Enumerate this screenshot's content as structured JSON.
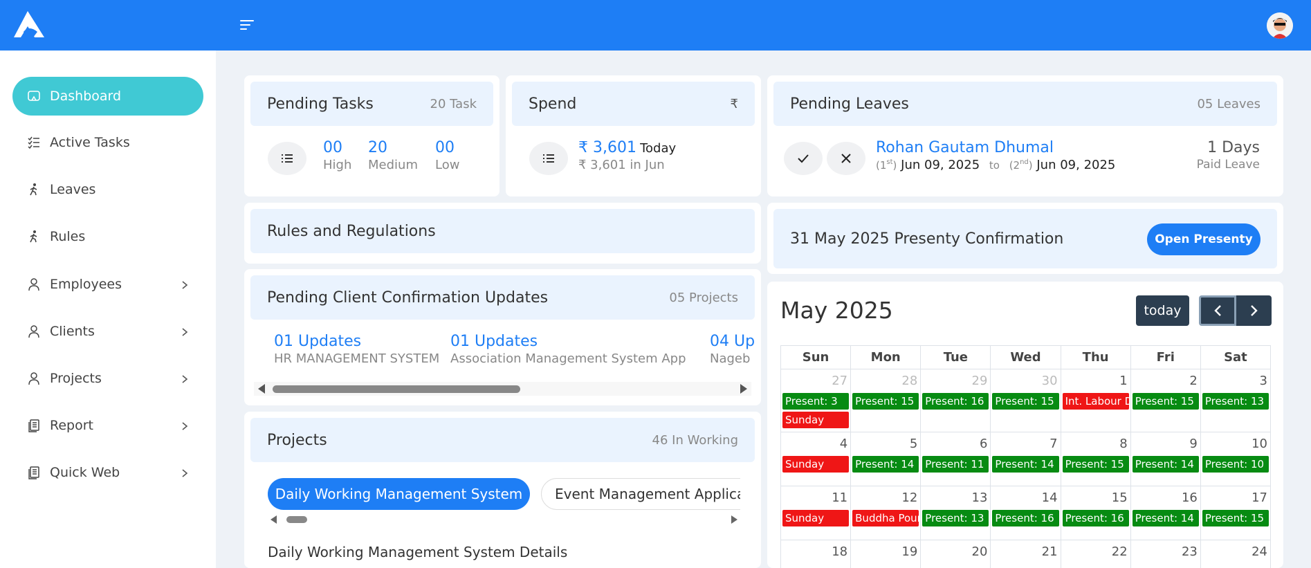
{
  "header": {
    "menu_icon": "menu-icon",
    "logo": "app-logo",
    "avatar": "user-avatar"
  },
  "sidebar": {
    "items": [
      {
        "label": "Dashboard",
        "icon": "dashboard-icon"
      },
      {
        "label": "Active Tasks",
        "icon": "checklist-icon"
      },
      {
        "label": "Leaves",
        "icon": "walking-icon"
      },
      {
        "label": "Rules",
        "icon": "walking-icon"
      },
      {
        "label": "Employees",
        "icon": "user-icon"
      },
      {
        "label": "Clients",
        "icon": "user-icon"
      },
      {
        "label": "Projects",
        "icon": "user-icon"
      },
      {
        "label": "Report",
        "icon": "document-icon"
      },
      {
        "label": "Quick Web",
        "icon": "document-icon"
      }
    ]
  },
  "pending_tasks": {
    "title": "Pending Tasks",
    "count": "20 Task",
    "high_value": "00",
    "high_label": "High",
    "medium_value": "20",
    "medium_label": "Medium",
    "low_value": "00",
    "low_label": "Low"
  },
  "spend": {
    "title": "Spend",
    "currency_icon": "₹",
    "today_value": "₹ 3,601",
    "today_label": "Today",
    "month_text": "₹ 3,601 in Jun"
  },
  "pending_leaves": {
    "title": "Pending Leaves",
    "count": "05 Leaves",
    "name": "Rohan Gautam Dhumal",
    "from_half": "(1",
    "from_sup": "st",
    "from_close": ")",
    "from_date": "Jun 09, 2025",
    "to_word": "to",
    "to_half": "(2",
    "to_sup": "nd",
    "to_close": ")",
    "to_date": "Jun 09, 2025",
    "days": "1 Days",
    "type": "Paid Leave"
  },
  "rules": {
    "title": "Rules and Regulations"
  },
  "presenty": {
    "title": "31 May 2025 Presenty Confirmation",
    "button": "Open Presenty"
  },
  "client_updates": {
    "title": "Pending Client Confirmation Updates",
    "count": "05 Projects",
    "items": [
      {
        "value": "01 Updates",
        "project": "HR MANAGEMENT SYSTEM"
      },
      {
        "value": "01 Updates",
        "project": "Association Management System App"
      },
      {
        "value": "04 Up",
        "project": "Nageb"
      }
    ]
  },
  "projects": {
    "title": "Projects",
    "count": "46 In Working",
    "tabs": [
      "Daily Working Management System",
      "Event Management Applica"
    ],
    "details_title": "Daily Working Management System Details"
  },
  "calendar": {
    "title": "May 2025",
    "today_button": "today",
    "days": [
      "Sun",
      "Mon",
      "Tue",
      "Wed",
      "Thu",
      "Fri",
      "Sat"
    ],
    "weeks": [
      [
        {
          "d": "27",
          "o": true,
          "ev": [
            {
              "t": "Present: 3",
              "c": "g"
            },
            {
              "t": "Sunday",
              "c": "r"
            }
          ]
        },
        {
          "d": "28",
          "o": true,
          "ev": [
            {
              "t": "Present: 15",
              "c": "g"
            }
          ]
        },
        {
          "d": "29",
          "o": true,
          "ev": [
            {
              "t": "Present: 16",
              "c": "g"
            }
          ]
        },
        {
          "d": "30",
          "o": true,
          "ev": [
            {
              "t": "Present: 15",
              "c": "g"
            }
          ]
        },
        {
          "d": "1",
          "ev": [
            {
              "t": "Int. Labour Day",
              "c": "r"
            }
          ]
        },
        {
          "d": "2",
          "ev": [
            {
              "t": "Present: 15",
              "c": "g"
            }
          ]
        },
        {
          "d": "3",
          "ev": [
            {
              "t": "Present: 13",
              "c": "g"
            }
          ]
        }
      ],
      [
        {
          "d": "4",
          "ev": [
            {
              "t": "Sunday",
              "c": "r"
            }
          ]
        },
        {
          "d": "5",
          "ev": [
            {
              "t": "Present: 14",
              "c": "g"
            }
          ]
        },
        {
          "d": "6",
          "ev": [
            {
              "t": "Present: 11",
              "c": "g"
            }
          ]
        },
        {
          "d": "7",
          "ev": [
            {
              "t": "Present: 14",
              "c": "g"
            }
          ]
        },
        {
          "d": "8",
          "ev": [
            {
              "t": "Present: 15",
              "c": "g"
            }
          ]
        },
        {
          "d": "9",
          "ev": [
            {
              "t": "Present: 14",
              "c": "g"
            }
          ]
        },
        {
          "d": "10",
          "ev": [
            {
              "t": "Present: 10",
              "c": "g"
            }
          ]
        }
      ],
      [
        {
          "d": "11",
          "ev": [
            {
              "t": "Sunday",
              "c": "r"
            }
          ]
        },
        {
          "d": "12",
          "ev": [
            {
              "t": "Buddha Pournima",
              "c": "r"
            }
          ]
        },
        {
          "d": "13",
          "ev": [
            {
              "t": "Present: 13",
              "c": "g"
            }
          ]
        },
        {
          "d": "14",
          "ev": [
            {
              "t": "Present: 16",
              "c": "g"
            }
          ]
        },
        {
          "d": "15",
          "ev": [
            {
              "t": "Present: 16",
              "c": "g"
            }
          ]
        },
        {
          "d": "16",
          "ev": [
            {
              "t": "Present: 14",
              "c": "g"
            }
          ]
        },
        {
          "d": "17",
          "ev": [
            {
              "t": "Present: 15",
              "c": "g"
            }
          ]
        }
      ],
      [
        {
          "d": "18",
          "ev": []
        },
        {
          "d": "19",
          "ev": []
        },
        {
          "d": "20",
          "ev": []
        },
        {
          "d": "21",
          "ev": []
        },
        {
          "d": "22",
          "ev": []
        },
        {
          "d": "23",
          "ev": []
        },
        {
          "d": "24",
          "ev": []
        }
      ]
    ]
  },
  "colors": {
    "primary": "#1e7ef5",
    "accent": "#40c9d4",
    "present": "#078b12",
    "holiday": "#ef1616",
    "dark_button": "#2c3e50"
  }
}
